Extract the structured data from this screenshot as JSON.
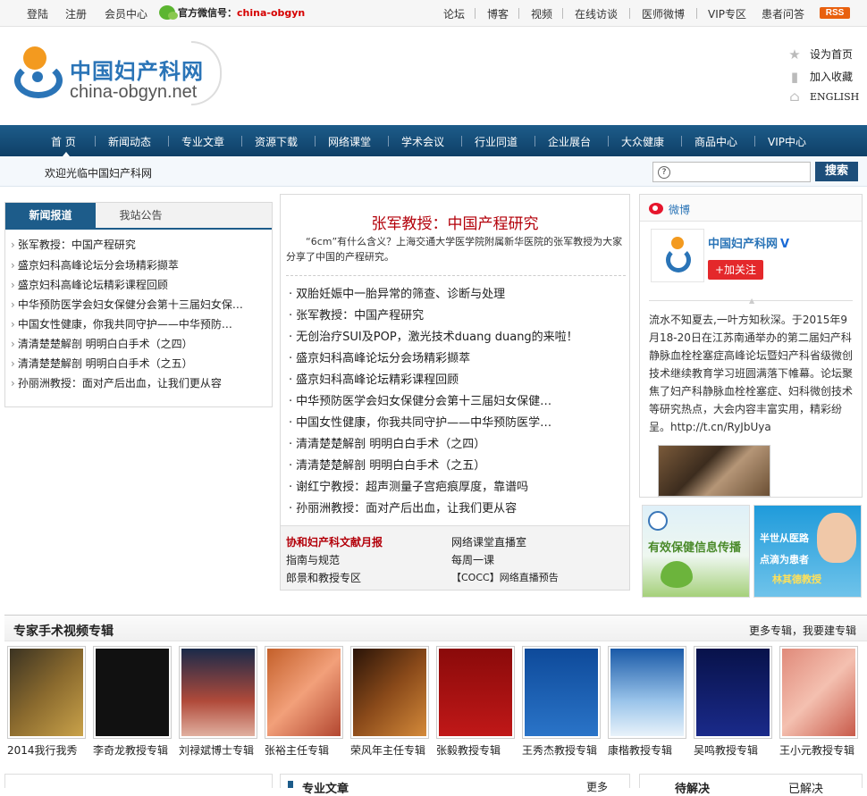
{
  "topbar": {
    "left": [
      "登陆",
      "注册",
      "会员中心"
    ],
    "wechat_label": "官方微信号：",
    "wechat_id": "china-obgyn",
    "right": [
      "论坛",
      "博客",
      "视频",
      "在线访谈",
      "医师微博",
      "VIP专区",
      "患者问答"
    ],
    "rss": "RSS"
  },
  "logo": {
    "cn": "中国妇产科网",
    "en": "china-obgyn.net"
  },
  "quick": {
    "home": "设为首页",
    "fav": "加入收藏",
    "english": "ENGLISH"
  },
  "nav": [
    "首 页",
    "新闻动态",
    "专业文章",
    "资源下载",
    "网络课堂",
    "学术会议",
    "行业同道",
    "企业展台",
    "大众健康",
    "商品中心",
    "VIP中心"
  ],
  "welcome": "欢迎光临中国妇产科网",
  "search": {
    "button": "搜索",
    "icon": "?"
  },
  "news": {
    "tab_active": "新闻报道",
    "tab_other": "我站公告",
    "items": [
      "张军教授：中国产程研究",
      "盛京妇科高峰论坛分会场精彩撷萃",
      "盛京妇科高峰论坛精彩课程回顾",
      "中华预防医学会妇女保健分会第十三届妇女保…",
      "中国女性健康，你我共同守护——中华预防…",
      "清清楚楚解剖 明明白白手术（之四）",
      "清清楚楚解剖 明明白白手术（之五）",
      "孙丽洲教授：面对产后出血，让我们更从容"
    ]
  },
  "center": {
    "title": "张军教授：中国产程研究",
    "desc": "“6cm”有什么含义？上海交通大学医学院附属新华医院的张军教授为大家分享了中国的产程研究。",
    "items": [
      "双胎妊娠中一胎异常的筛查、诊断与处理",
      "张军教授：中国产程研究",
      "无创治疗SUI及POP，激光技术duang duang的来啦！",
      "盛京妇科高峰论坛分会场精彩撷萃",
      "盛京妇科高峰论坛精彩课程回顾",
      "中华预防医学会妇女保健分会第十三届妇女保健…",
      "中国女性健康，你我共同守护——中华预防医学…",
      "清清楚楚解剖 明明白白手术（之四）",
      "清清楚楚解剖 明明白白手术（之五）",
      "谢红宁教授：超声测量子宫疤痕厚度，靠谱吗",
      "孙丽洲教授：面对产后出血，让我们更从容"
    ],
    "links": {
      "l1": "协和妇产科文献月报",
      "l2": "网络课堂直播室",
      "l3": "指南与规范",
      "l4": "每周一课",
      "l5": "郎景和教授专区",
      "l6": "【COCC】网络直播预告"
    }
  },
  "weibo": {
    "title": "微博",
    "account": "中国妇产科网",
    "verified": "V",
    "follow": "+加关注",
    "text": "流水不知夏去,一叶方知秋深。于2015年9月18-20日在江苏南通举办的第二届妇产科静脉血栓栓塞症高峰论坛暨妇产科省级微创技术继续教育学习班圆满落下帷幕。论坛聚焦了妇产科静脉血栓栓塞症、妇科微创技术等研究热点，大会内容丰富实用，精彩纷呈。http://t.cn/RyJbUya"
  },
  "ads": {
    "ad1": "有效保健信息传播",
    "ad2_a": "半世从医路",
    "ad2_b": "点滴为患者",
    "ad2_c": "林其德教授"
  },
  "videos": {
    "title": "专家手术视频专辑",
    "more": "更多专辑，我要建专辑",
    "items": [
      "2014我行我秀",
      "李奇龙教授专辑",
      "刘禄斌博士专辑",
      "张裕主任专辑",
      "荣风年主任专辑",
      "张毅教授专辑",
      "王秀杰教授专辑",
      "康楷教授专辑",
      "吴鸣教授专辑",
      "王小元教授专辑"
    ]
  },
  "bottom": {
    "articles": "专业文章",
    "more": "更多",
    "pending": "待解决",
    "solved": "已解决"
  },
  "colors": {
    "nav": "#1d5c8a",
    "title_red": "#b3000a",
    "accent_blue": "#2a74b7"
  }
}
